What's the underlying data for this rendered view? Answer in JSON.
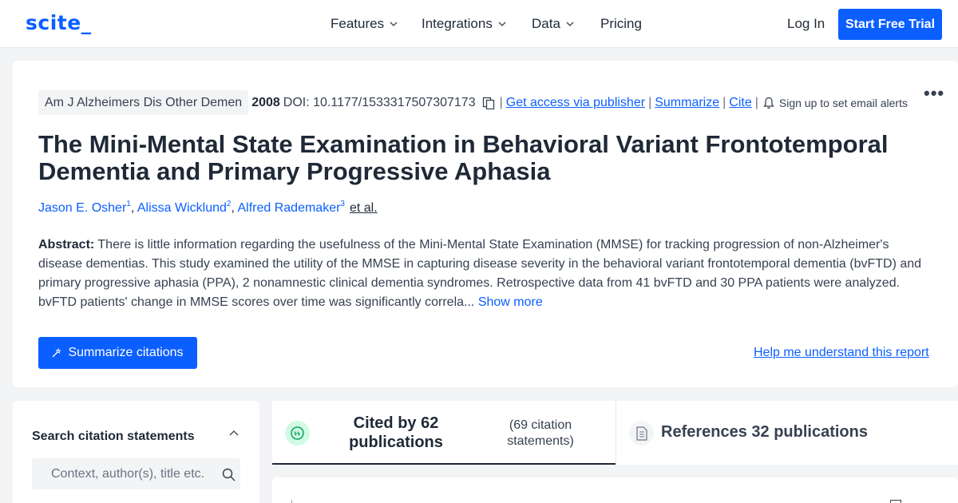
{
  "nav": {
    "logo": "scite_",
    "items": [
      {
        "label": "Features",
        "has_dropdown": true
      },
      {
        "label": "Integrations",
        "has_dropdown": true
      },
      {
        "label": "Data",
        "has_dropdown": true
      },
      {
        "label": "Pricing",
        "has_dropdown": false
      }
    ],
    "login": "Log In",
    "cta": "Start Free Trial"
  },
  "paper": {
    "journal": "Am J Alzheimers Dis Other Demen",
    "year": "2008",
    "doi": "DOI: 10.1177/1533317507307173",
    "links": {
      "publisher": "Get access via publisher",
      "summarize": "Summarize",
      "cite": "Cite"
    },
    "alerts": "Sign up to set email alerts",
    "title": "The Mini-Mental State Examination in Behavioral Variant Frontotemporal Dementia and Primary Progressive Aphasia",
    "authors": [
      {
        "name": "Jason E. Osher",
        "sup": "1"
      },
      {
        "name": "Alissa Wicklund",
        "sup": "2"
      },
      {
        "name": "Alfred Rademaker",
        "sup": "3"
      }
    ],
    "et_al": "et al.",
    "abstract_label": "Abstract:",
    "abstract_text": "There is little information regarding the usefulness of the Mini-Mental State Examination (MMSE) for tracking progression of non-Alzheimer's disease dementias. This study examined the utility of the MMSE in capturing disease severity in the behavioral variant frontotemporal dementia (bvFTD) and primary progressive aphasia (PPA), 2 nonamnestic clinical dementia syndromes. Retrospective data from 41 bvFTD and 30 PPA patients were analyzed. bvFTD patients' change in MMSE scores over time was significantly correla...",
    "show_more": "Show more",
    "summarize_citations": "Summarize citations",
    "help": "Help me understand this report"
  },
  "search_panel": {
    "title": "Search citation statements",
    "placeholder": "Context, author(s), title etc."
  },
  "tabs": {
    "cited_by": "Cited by 62 publications",
    "cited_statements": "(69 citation statements)",
    "references": "References 32 publications"
  },
  "colors": {
    "brand": "#0b5fff",
    "quote_bg": "#d1fae5",
    "quote_icon": "#10a35a"
  }
}
